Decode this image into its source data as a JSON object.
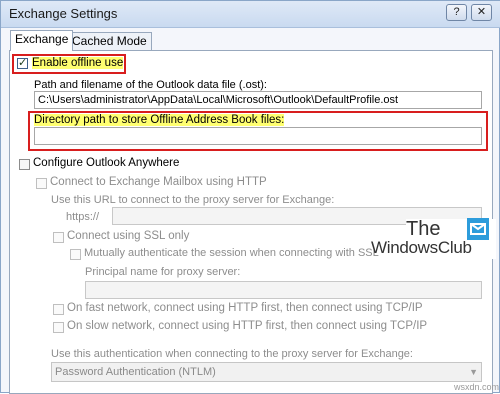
{
  "window": {
    "title": "Exchange Settings"
  },
  "titlebar_buttons": {
    "help": "?",
    "close": "✕"
  },
  "tabs": [
    {
      "label": "Exchange"
    },
    {
      "label": "Cached Mode"
    }
  ],
  "offline": {
    "enable_label": "Enable offline use",
    "enable_checked": true,
    "ost_label": "Path and filename of the Outlook data file (.ost):",
    "ost_value": "C:\\Users\\administrator\\AppData\\Local\\Microsoft\\Outlook\\DefaultProfile.ost",
    "oab_label": "Directory path to store Offline Address Book files:",
    "oab_value": ""
  },
  "anywhere": {
    "configure_label": "Configure Outlook Anywhere",
    "connect_http_label": "Connect to Exchange Mailbox using HTTP",
    "url_label": "Use this URL to connect to the proxy server for Exchange:",
    "url_prefix": "https://",
    "url_value": "",
    "ssl_label": "Connect using SSL only",
    "mutual_label": "Mutually authenticate the session when connecting with SSL",
    "principal_label": "Principal name for proxy server:",
    "principal_value": "",
    "fast_label": "On fast network, connect using HTTP first, then connect using TCP/IP",
    "slow_label": "On slow network, connect using HTTP first, then connect using TCP/IP",
    "auth_label": "Use this authentication when connecting to the proxy server for Exchange:",
    "auth_value": "Password Authentication (NTLM)"
  },
  "branding": {
    "logo_line1": "The",
    "logo_line2": "WindowsClub",
    "watermark": "wsxdn.com"
  },
  "colors": {
    "highlight": "#ffff70",
    "annotation_red": "#d81e1e",
    "logo_blue": "#2d9cdb"
  }
}
